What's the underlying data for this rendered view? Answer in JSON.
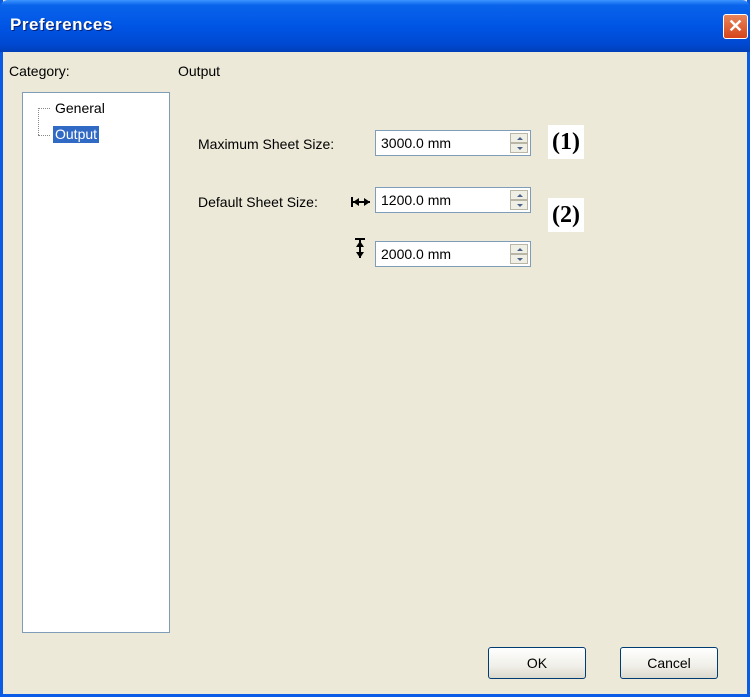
{
  "window": {
    "title": "Preferences",
    "close_glyph": "✕"
  },
  "category": {
    "label": "Category:",
    "items": [
      {
        "label": "General",
        "selected": false
      },
      {
        "label": "Output",
        "selected": true
      }
    ]
  },
  "panel": {
    "title": "Output",
    "max_sheet_size": {
      "label": "Maximum Sheet Size:",
      "value": "3000.0 mm",
      "callout": "(1)"
    },
    "default_sheet_size": {
      "label": "Default Sheet Size:",
      "width_value": "1200.0 mm",
      "height_value": "2000.0 mm",
      "callout": "(2)",
      "width_icon": "horizontal-double-arrow-icon",
      "height_icon": "vertical-double-arrow-icon"
    }
  },
  "buttons": {
    "ok": "OK",
    "cancel": "Cancel"
  },
  "colors": {
    "titlebar": "#0055e5",
    "selection": "#316ac5",
    "close": "#d6441a",
    "dialog_bg": "#ece9d8"
  }
}
